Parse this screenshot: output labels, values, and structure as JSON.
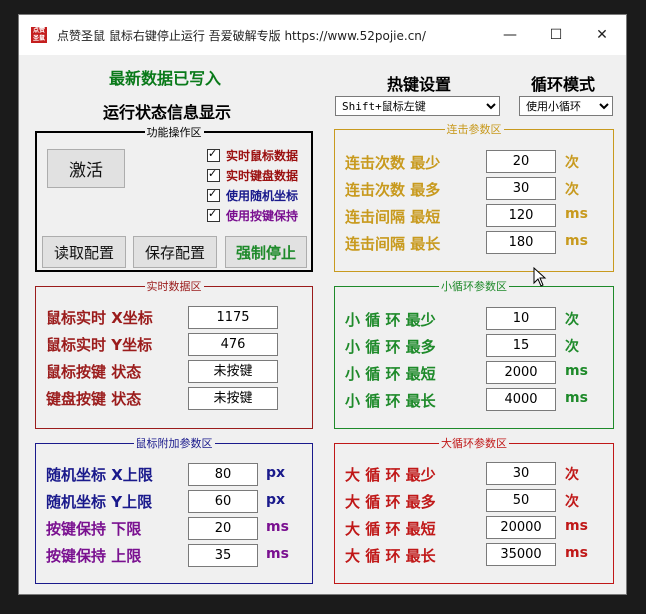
{
  "window": {
    "title": "点赞圣鼠 鼠标右键停止运行 吾爱破解专版 https://www.52pojie.cn/",
    "icon_text": "点赞圣鼠",
    "controls": {
      "minimize": "—",
      "maximize": "☐",
      "close": "✕"
    }
  },
  "status_written": "最新数据已写入",
  "status_display": "运行状态信息显示",
  "hotkey": {
    "title": "热键设置",
    "selected": "Shift+鼠标左键"
  },
  "loop_mode": {
    "title": "循环模式",
    "selected": "使用小循环"
  },
  "function_group": {
    "title": "功能操作区",
    "activate": "激活",
    "checkboxes": [
      "实时鼠标数据",
      "实时键盘数据",
      "使用随机坐标",
      "使用按键保持"
    ],
    "read_config": "读取配置",
    "save_config": "保存配置",
    "force_stop": "强制停止"
  },
  "combo_group": {
    "title": "连击参数区",
    "rows": [
      {
        "label": "连击次数  最少",
        "value": "20",
        "unit": "次"
      },
      {
        "label": "连击次数  最多",
        "value": "30",
        "unit": "次"
      },
      {
        "label": "连击间隔  最短",
        "value": "120",
        "unit": "ms"
      },
      {
        "label": "连击间隔  最长",
        "value": "180",
        "unit": "ms"
      }
    ]
  },
  "realtime_group": {
    "title": "实时数据区",
    "rows": [
      {
        "label": "鼠标实时  X坐标",
        "value": "1175"
      },
      {
        "label": "鼠标实时  Y坐标",
        "value": "476"
      },
      {
        "label": "鼠标按键  状态",
        "value": "未按键"
      },
      {
        "label": "键盘按键  状态",
        "value": "未按键"
      }
    ]
  },
  "small_loop_group": {
    "title": "小循环参数区",
    "rows": [
      {
        "label": "小  循  环  最少",
        "value": "10",
        "unit": "次"
      },
      {
        "label": "小  循  环  最多",
        "value": "15",
        "unit": "次"
      },
      {
        "label": "小  循  环  最短",
        "value": "2000",
        "unit": "ms"
      },
      {
        "label": "小  循  环  最长",
        "value": "4000",
        "unit": "ms"
      }
    ]
  },
  "mouse_extra_group": {
    "title": "鼠标附加参数区",
    "rows": [
      {
        "label": "随机坐标  X上限",
        "value": "80",
        "unit": "px"
      },
      {
        "label": "随机坐标  Y上限",
        "value": "60",
        "unit": "px"
      },
      {
        "label": "按键保持  下限",
        "value": "20",
        "unit": "ms"
      },
      {
        "label": "按键保持  上限",
        "value": "35",
        "unit": "ms"
      }
    ]
  },
  "big_loop_group": {
    "title": "大循环参数区",
    "rows": [
      {
        "label": "大  循  环  最少",
        "value": "30",
        "unit": "次"
      },
      {
        "label": "大  循  环  最多",
        "value": "50",
        "unit": "次"
      },
      {
        "label": "大  循  环  最短",
        "value": "20000",
        "unit": "ms"
      },
      {
        "label": "大  循  环  最长",
        "value": "35000",
        "unit": "ms"
      }
    ]
  },
  "colors": {
    "function_border": "#000000",
    "function_red": "#9b1010",
    "function_purple": "#7a1090",
    "combo": "#c89a1e",
    "realtime": "#9b1c1c",
    "small_loop": "#1e8a2a",
    "mouse_extra": "#1a1a8c",
    "mouse_extra_purple": "#7a1090",
    "big_loop": "#c01818",
    "status_green": "#0a7a1a"
  }
}
